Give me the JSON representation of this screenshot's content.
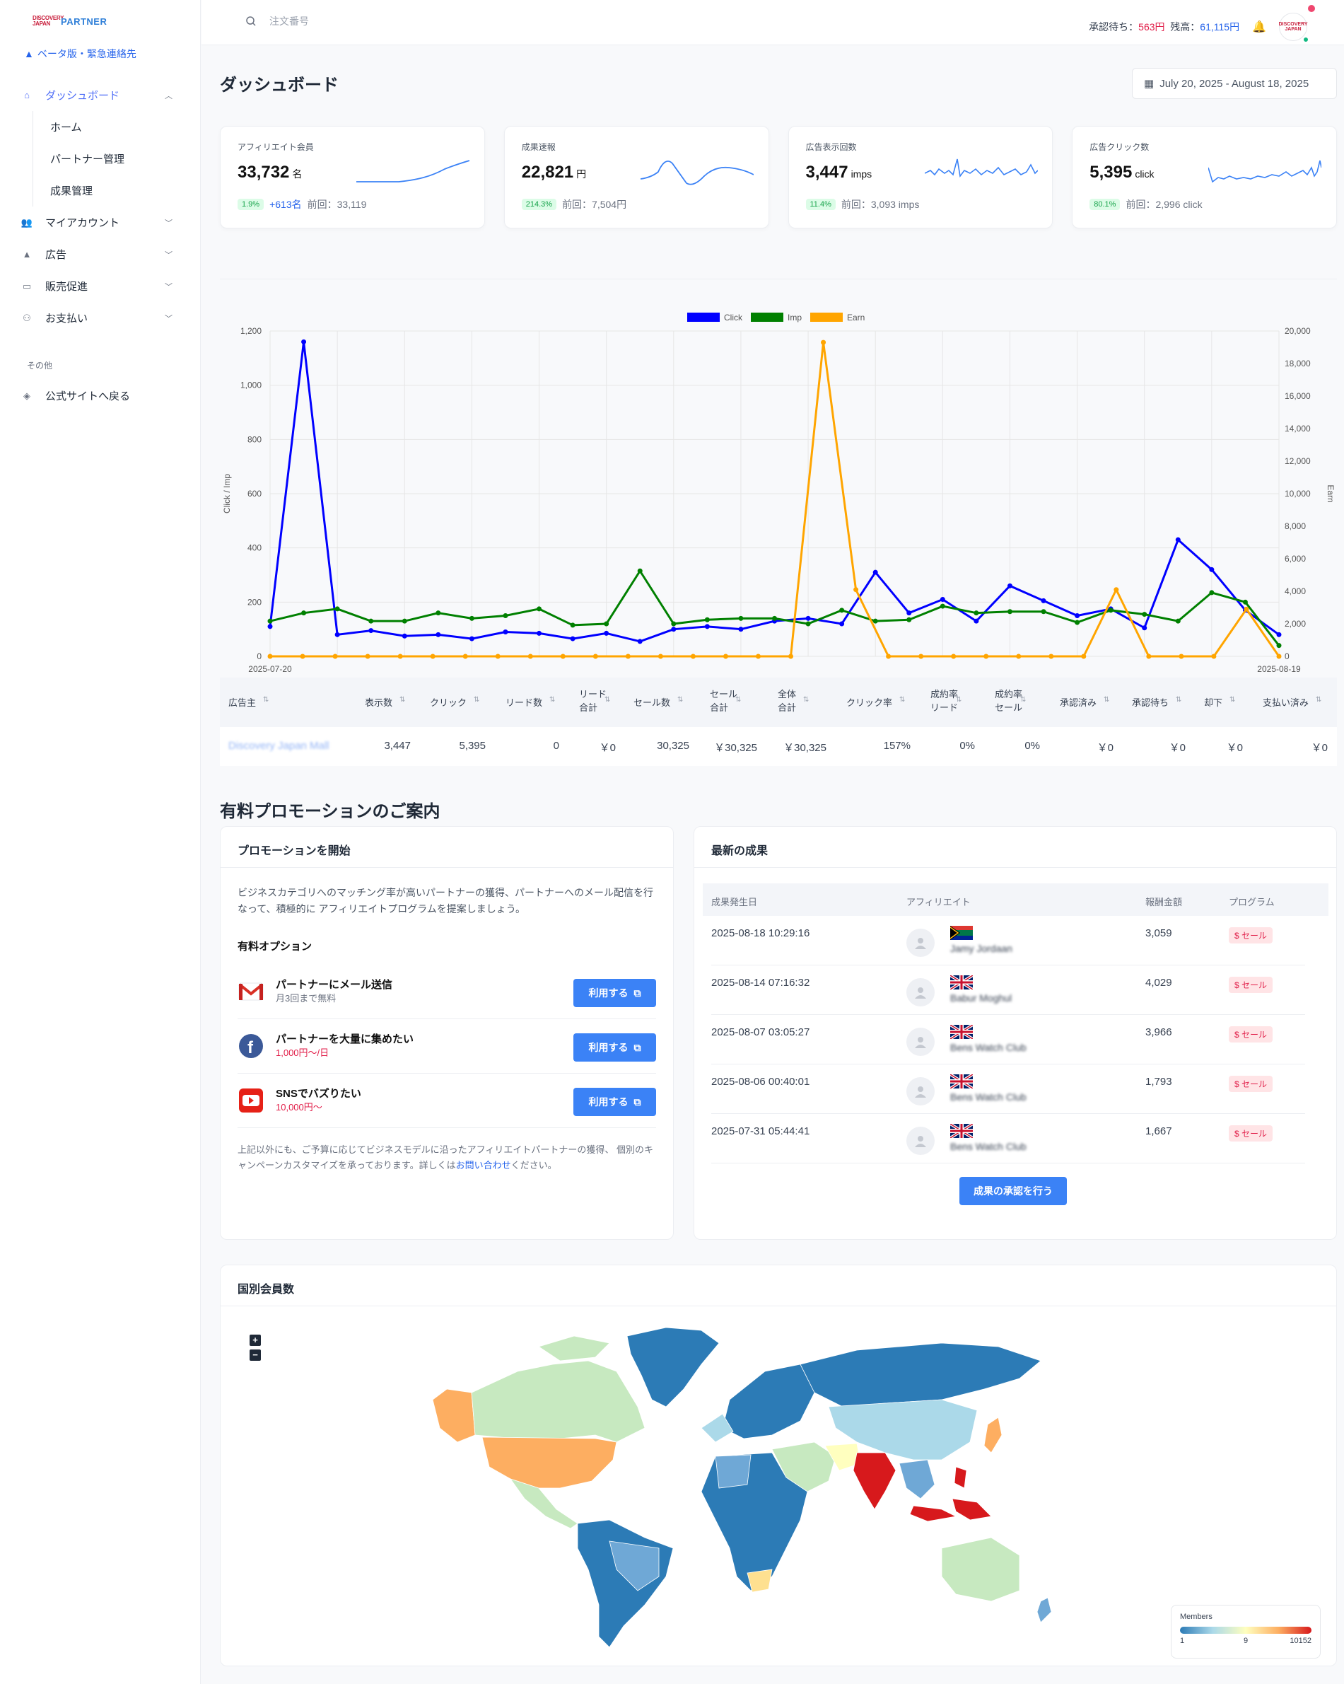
{
  "brand": {
    "mark": "DISCOVERY JAPAN",
    "name": "PARTNER"
  },
  "beta_notice": "ベータ版・緊急連絡先",
  "nav": {
    "dashboard": "ダッシュボード",
    "sub": [
      "ホーム",
      "パートナー管理",
      "成果管理"
    ],
    "items": [
      "マイアカウント",
      "広告",
      "販売促進",
      "お支払い"
    ],
    "section": "その他",
    "back": "公式サイトへ戻る"
  },
  "topbar": {
    "search_placeholder": "注文番号",
    "pending_label": "承認待ち：",
    "pending_value": "563円",
    "balance_label": "残高：",
    "balance_value": "61,115円"
  },
  "page_title": "ダッシュボード",
  "date_range": "July 20, 2025 - August 18, 2025",
  "cards": [
    {
      "label": "アフィリエイト会員",
      "value": "33,732",
      "unit": "名",
      "badge": "1.9%",
      "plus": "+613名",
      "prev": "前回：33,119"
    },
    {
      "label": "成果速報",
      "value": "22,821",
      "unit": "円",
      "badge": "214.3%",
      "prev": "前回：7,504円"
    },
    {
      "label": "広告表示回数",
      "value": "3,447",
      "unit": "imps",
      "badge": "11.4%",
      "prev": "前回：3,093 imps"
    },
    {
      "label": "広告クリック数",
      "value": "5,395",
      "unit": "click",
      "badge": "80.1%",
      "prev": "前回：2,996 click"
    }
  ],
  "chart_data": {
    "type": "line",
    "legend": [
      "Click",
      "Imp",
      "Earn"
    ],
    "ylabel": "Click / Imp",
    "y2label": "Earn",
    "ylim": [
      0,
      1200
    ],
    "y2lim": [
      0,
      20000
    ],
    "yticks": [
      "0",
      "200",
      "400",
      "600",
      "800",
      "1,000",
      "1,200"
    ],
    "y2ticks": [
      "0",
      "2,000",
      "4,000",
      "6,000",
      "8,000",
      "10,000",
      "12,000",
      "14,000",
      "16,000",
      "18,000",
      "20,000"
    ],
    "x_first": "2025-07-20",
    "x_last": "2025-08-19",
    "colors": {
      "Click": "#0000ff",
      "Imp": "#008000",
      "Earn": "#ffa500"
    },
    "series": [
      {
        "name": "Click",
        "axis": "left",
        "values": [
          110,
          1160,
          80,
          95,
          75,
          80,
          65,
          90,
          85,
          65,
          85,
          55,
          100,
          110,
          100,
          130,
          140,
          120,
          310,
          160,
          210,
          130,
          260,
          205,
          150,
          175,
          105,
          430,
          320,
          170,
          80
        ]
      },
      {
        "name": "Imp",
        "axis": "left",
        "values": [
          130,
          160,
          175,
          130,
          130,
          160,
          140,
          150,
          175,
          115,
          120,
          315,
          120,
          135,
          140,
          140,
          120,
          170,
          130,
          135,
          185,
          160,
          165,
          165,
          125,
          170,
          155,
          130,
          235,
          200,
          40
        ]
      },
      {
        "name": "Earn",
        "axis": "right",
        "values": [
          0,
          0,
          0,
          0,
          0,
          0,
          0,
          0,
          0,
          0,
          0,
          0,
          0,
          0,
          0,
          0,
          0,
          19300,
          4100,
          0,
          0,
          0,
          0,
          0,
          0,
          0,
          4100,
          0,
          0,
          0,
          2900,
          0
        ]
      }
    ]
  },
  "table": {
    "headers": [
      "広告主",
      "表示数",
      "クリック",
      "リード数",
      "リード\n合計",
      "セール数",
      "セール\n合計",
      "全体\n合計",
      "クリック率",
      "成約率\nリード",
      "成約率\nセール",
      "承認済み",
      "承認待ち",
      "却下",
      "支払い済み"
    ],
    "row": [
      "Discovery Japan Mall",
      "3,447",
      "5,395",
      "0",
      "￥0",
      "30,325",
      "￥30,325",
      "￥30,325",
      "157%",
      "0%",
      "0%",
      "￥0",
      "￥0",
      "￥0",
      "￥0"
    ]
  },
  "promo": {
    "title": "有料プロモーションのご案内",
    "panel_title": "プロモーションを開始",
    "desc": "ビジネスカテゴリへのマッチング率が高いパートナーの獲得、パートナーへのメール配信を行なって、積極的に アフィリエイトプログラムを提案しましょう。",
    "options_title": "有料オプション",
    "options": [
      {
        "icon": "gmail-icon",
        "title": "パートナーにメール送信",
        "sub": "月3回まで無料"
      },
      {
        "icon": "facebook-icon",
        "title": "パートナーを大量に集めたい",
        "sub": "1,000円～/日"
      },
      {
        "icon": "youtube-icon",
        "title": "SNSでバズりたい",
        "sub": "10,000円～"
      }
    ],
    "button": "利用する",
    "note_pre": "上記以外にも、ご予算に応じてビジネスモデルに沿ったアフィリエイトパートナーの獲得、 個別のキャンペーンカスタマイズを承っております。詳しくは",
    "note_link": "お問い合わせ",
    "note_post": "ください。"
  },
  "results": {
    "title": "最新の成果",
    "headers": [
      "成果発生日",
      "アフィリエイト",
      "報酬金額",
      "プログラム"
    ],
    "rows": [
      {
        "date": "2025-08-18 10:29:16",
        "flag": "za",
        "name": "Jamy Jordaan",
        "amount": "3,059",
        "program": "$ セール"
      },
      {
        "date": "2025-08-14 07:16:32",
        "flag": "gb",
        "name": "Babur Moghul",
        "amount": "4,029",
        "program": "$ セール"
      },
      {
        "date": "2025-08-07 03:05:27",
        "flag": "gb",
        "name": "Bens Watch Club",
        "amount": "3,966",
        "program": "$ セール"
      },
      {
        "date": "2025-08-06 00:40:01",
        "flag": "gb",
        "name": "Bens Watch Club",
        "amount": "1,793",
        "program": "$ セール"
      },
      {
        "date": "2025-07-31 05:44:41",
        "flag": "gb",
        "name": "Bens Watch Club",
        "amount": "1,667",
        "program": "$ セール"
      }
    ],
    "approve_button": "成果の承認を行う"
  },
  "map": {
    "title": "国別会員数",
    "legend_title": "Members",
    "legend_min": "1",
    "legend_mid": "9",
    "legend_max": "10152"
  }
}
